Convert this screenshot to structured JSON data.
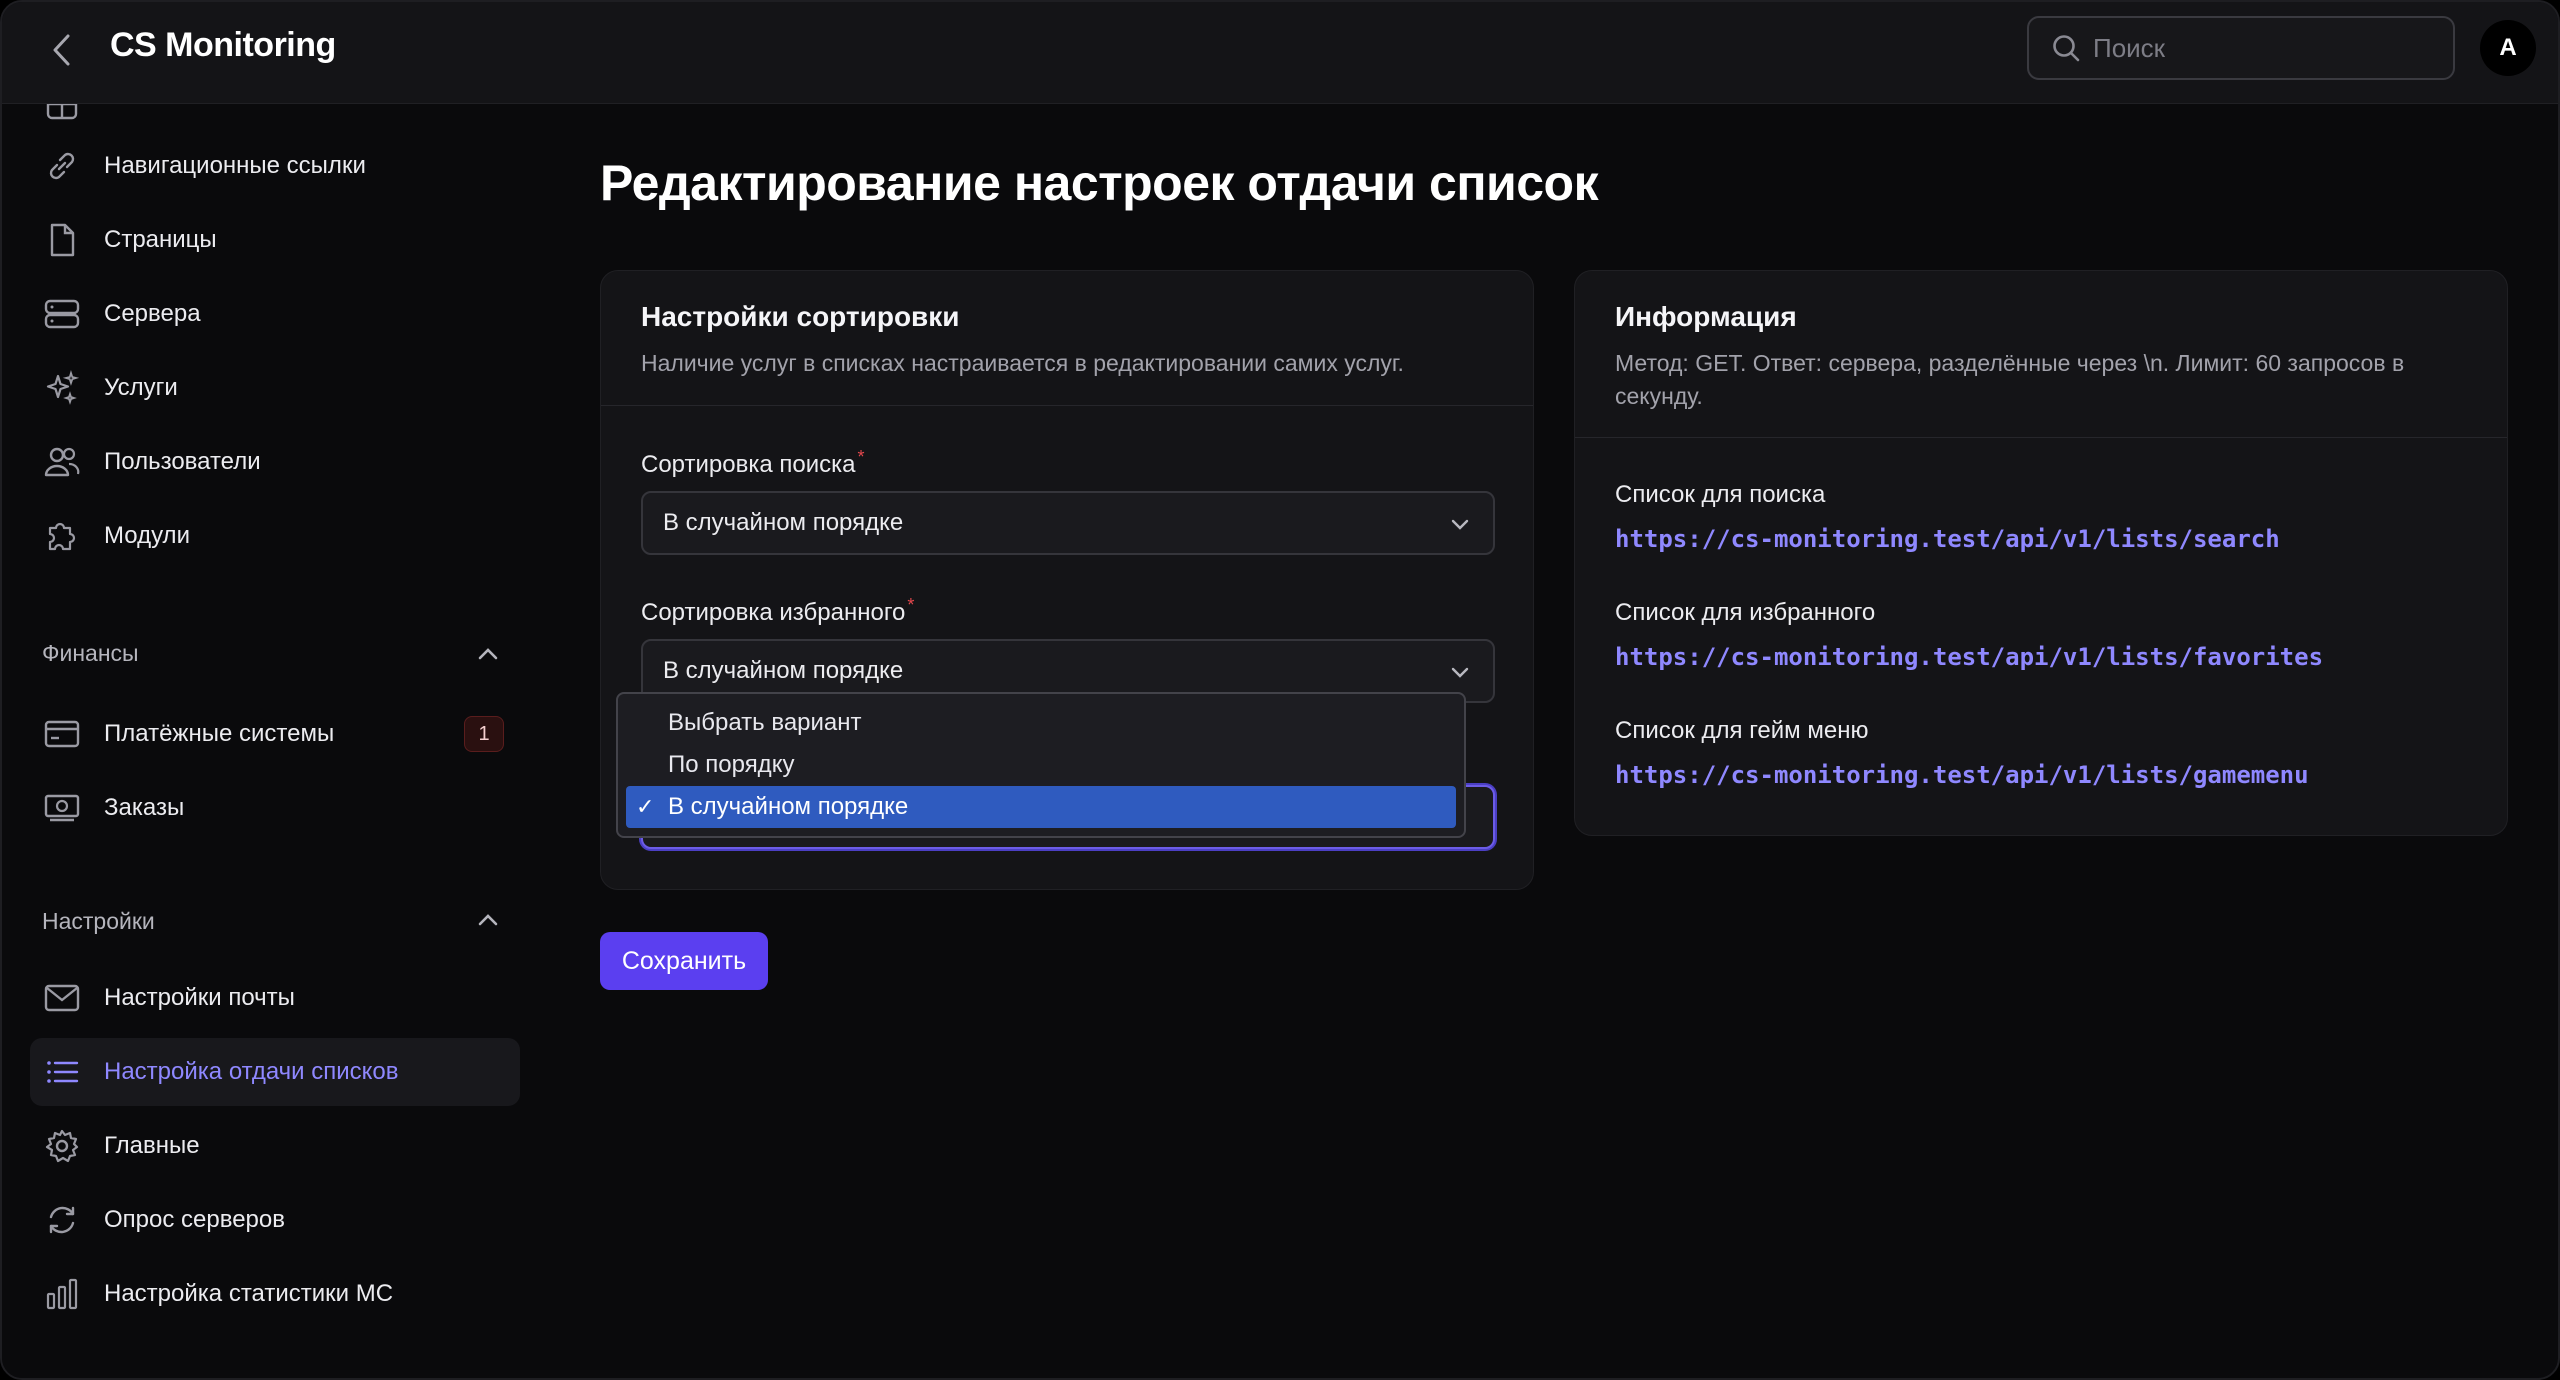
{
  "header": {
    "title": "CS Monitoring",
    "search_placeholder": "Поиск",
    "avatar_letter": "A"
  },
  "sidebar": {
    "items_top": [
      {
        "label": "Навигационные ссылки",
        "icon": "link-icon"
      },
      {
        "label": "Страницы",
        "icon": "file-icon"
      },
      {
        "label": "Сервера",
        "icon": "server-icon"
      },
      {
        "label": "Услуги",
        "icon": "sparkles-icon"
      },
      {
        "label": "Пользователи",
        "icon": "users-icon"
      },
      {
        "label": "Модули",
        "icon": "puzzle-icon"
      }
    ],
    "finance_title": "Финансы",
    "finance_items": [
      {
        "label": "Платёжные системы",
        "icon": "credit-card-icon",
        "badge": "1"
      },
      {
        "label": "Заказы",
        "icon": "cash-icon"
      }
    ],
    "settings_title": "Настройки",
    "settings_items": [
      {
        "label": "Настройки почты",
        "icon": "mail-icon"
      },
      {
        "label": "Настройка отдачи списков",
        "icon": "list-icon",
        "active": true
      },
      {
        "label": "Главные",
        "icon": "gear-icon"
      },
      {
        "label": "Опрос серверов",
        "icon": "refresh-icon"
      },
      {
        "label": "Настройка статистики МС",
        "icon": "bar-chart-icon"
      }
    ]
  },
  "main": {
    "page_title": "Редактирование настроек отдачи список",
    "sort_card": {
      "title": "Настройки сортировки",
      "desc": "Наличие услуг в списках настраивается в редактировании самих услуг.",
      "search_label": "Сортировка поиска",
      "search_value": "В случайном порядке",
      "fav_label": "Сортировка избранного",
      "fav_value": "В случайном порядке"
    },
    "dropdown": {
      "options": [
        "Выбрать вариант",
        "По порядку",
        "В случайном порядке"
      ],
      "selected_index": 2,
      "check": "✓"
    },
    "save_label": "Сохранить",
    "info_card": {
      "title": "Информация",
      "desc": "Метод: GET. Ответ: сервера, разделённые через \\n. Лимит: 60 запросов в секунду.",
      "links": [
        {
          "label": "Список для поиска",
          "url": "https://cs-monitoring.test/api/v1/lists/search"
        },
        {
          "label": "Список для избранного",
          "url": "https://cs-monitoring.test/api/v1/lists/favorites"
        },
        {
          "label": "Список для гейм меню",
          "url": "https://cs-monitoring.test/api/v1/lists/gamemenu"
        }
      ]
    }
  }
}
